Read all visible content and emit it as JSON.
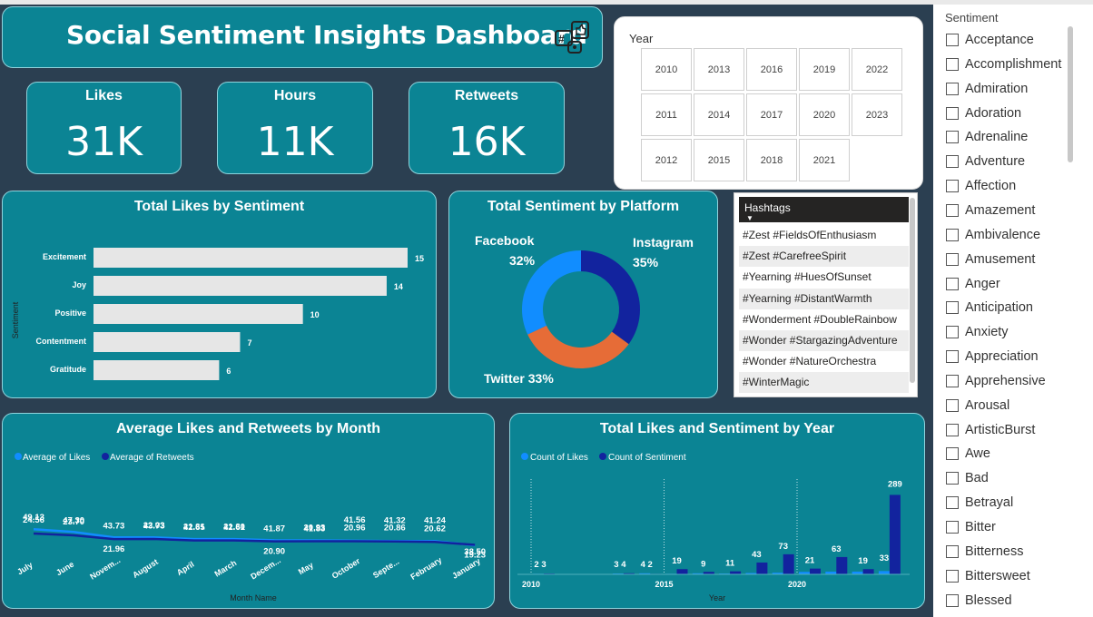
{
  "dashboard_title": "Social Sentiment Insights Dashboard",
  "kpis": [
    {
      "label": "Likes",
      "value": "31K"
    },
    {
      "label": "Hours",
      "value": "11K"
    },
    {
      "label": "Retweets",
      "value": "16K"
    }
  ],
  "year_slicer": {
    "label": "Year",
    "years": [
      "2010",
      "2013",
      "2016",
      "2019",
      "2022",
      "2011",
      "2014",
      "2017",
      "2020",
      "2023",
      "2012",
      "2015",
      "2018",
      "2021"
    ]
  },
  "hashtag_slicer": {
    "header": "Hashtags",
    "items": [
      "#Zest #FieldsOfEnthusiasm",
      "#Zest #CarefreeSpirit",
      "#Yearning #HuesOfSunset",
      "#Yearning #DistantWarmth",
      "#Wonderment #DoubleRainbow",
      "#Wonder #StargazingAdventure",
      "#Wonder #NatureOrchestra",
      "#WinterMagic"
    ]
  },
  "sentiment_slicer": {
    "label": "Sentiment",
    "items": [
      "Acceptance",
      "Accomplishment",
      "Admiration",
      "Adoration",
      "Adrenaline",
      "Adventure",
      "Affection",
      "Amazement",
      "Ambivalence",
      "Amusement",
      "Anger",
      "Anticipation",
      "Anxiety",
      "Appreciation",
      "Apprehensive",
      "Arousal",
      "ArtisticBurst",
      "Awe",
      "Bad",
      "Betrayal",
      "Bitter",
      "Bitterness",
      "Bittersweet",
      "Blessed"
    ]
  },
  "colors": {
    "card": "#0b8494",
    "canvas": "#2b3f51",
    "light_blue": "#118dff",
    "dark_blue": "#12239e",
    "orange": "#e66c37",
    "bar_gray": "#e6e6e6"
  },
  "chart_data": [
    {
      "type": "bar",
      "title": "Total Likes by Sentiment",
      "ylabel": "Sentiment",
      "categories": [
        "Excitement",
        "Joy",
        "Positive",
        "Contentment",
        "Gratitude"
      ],
      "values": [
        15,
        14,
        10,
        7,
        6
      ]
    },
    {
      "type": "pie",
      "title": "Total Sentiment by Platform",
      "labels": [
        "Instagram",
        "Twitter",
        "Facebook"
      ],
      "values": [
        35,
        33,
        32
      ],
      "value_labels": [
        "35%",
        "33%",
        "32%"
      ],
      "label_text": {
        "facebook": "Facebook",
        "facebook_pct": "32%",
        "instagram": "Instagram",
        "instagram_pct": "35%",
        "twitter": "Twitter 33%"
      }
    },
    {
      "type": "line",
      "title": "Average Likes and Retweets by Month",
      "xlabel": "Month Name",
      "categories": [
        "July",
        "June",
        "Novem...",
        "August",
        "April",
        "March",
        "Decem...",
        "May",
        "October",
        "Septe...",
        "February",
        "January"
      ],
      "series": [
        {
          "name": "Average of Likes",
          "values": [
            49.13,
            47.3,
            43.73,
            43.73,
            42.65,
            42.61,
            41.87,
            41.83,
            41.56,
            41.32,
            41.24,
            38.5
          ]
        },
        {
          "name": "Average of Retweets",
          "values": [
            24.56,
            23.7,
            21.96,
            22.03,
            21.31,
            21.3,
            20.9,
            20.93,
            20.96,
            20.86,
            20.62,
            19.23
          ]
        }
      ],
      "ylim": [
        0,
        60
      ]
    },
    {
      "type": "bar",
      "title": "Total Likes and Sentiment by Year",
      "xlabel": "Year",
      "tick_labels": [
        "2010",
        "2015",
        "2020"
      ],
      "x": [
        2010,
        2011,
        2012,
        2013,
        2014,
        2015,
        2016,
        2017,
        2018,
        2019,
        2020,
        2021,
        2022,
        2023
      ],
      "series": [
        {
          "name": "Count of Likes",
          "values": [
            2,
            1,
            1,
            3,
            4,
            2,
            4,
            3,
            5,
            6,
            9,
            10,
            10,
            12
          ]
        },
        {
          "name": "Count of Sentiment",
          "values": [
            3,
            1,
            1,
            4,
            2,
            19,
            9,
            11,
            43,
            73,
            21,
            63,
            19,
            289
          ]
        }
      ],
      "value_labels": [
        {
          "x": 2010,
          "text": "2 3"
        },
        {
          "x": 2013,
          "text": "3 4"
        },
        {
          "x": 2014,
          "text": "4 2"
        },
        {
          "x": 2015,
          "text": "19"
        },
        {
          "x": 2016,
          "text": "9"
        },
        {
          "x": 2017,
          "text": "11"
        },
        {
          "x": 2018,
          "text": "43"
        },
        {
          "x": 2019,
          "text": "73"
        },
        {
          "x": 2020,
          "text": "21"
        },
        {
          "x": 2021,
          "text": "63"
        },
        {
          "x": 2022,
          "text": "19"
        },
        {
          "x": 2023,
          "text": "33"
        },
        {
          "x": 2023,
          "text": "289"
        }
      ]
    }
  ]
}
